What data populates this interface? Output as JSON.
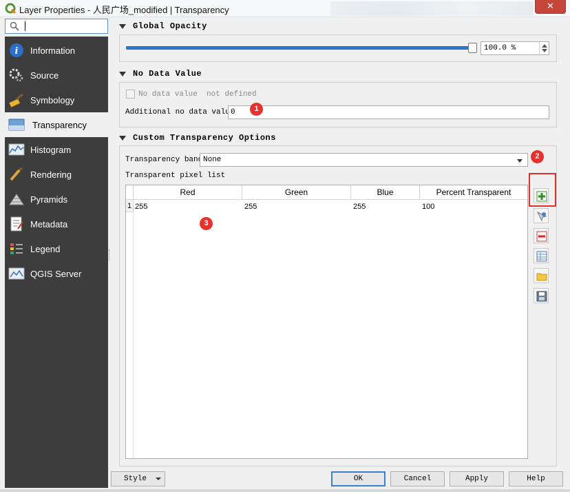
{
  "window": {
    "title": "Layer Properties - 人民广场_modified | Transparency",
    "close_label": "✕"
  },
  "search": {
    "value": ""
  },
  "sidebar": {
    "items": [
      {
        "label": "Information",
        "icon": "info-icon"
      },
      {
        "label": "Source",
        "icon": "source-icon"
      },
      {
        "label": "Symbology",
        "icon": "symbology-icon"
      },
      {
        "label": "Transparency",
        "icon": "transparency-icon",
        "active": true
      },
      {
        "label": "Histogram",
        "icon": "histogram-icon"
      },
      {
        "label": "Rendering",
        "icon": "rendering-icon"
      },
      {
        "label": "Pyramids",
        "icon": "pyramids-icon"
      },
      {
        "label": "Metadata",
        "icon": "metadata-icon"
      },
      {
        "label": "Legend",
        "icon": "legend-icon"
      },
      {
        "label": "QGIS Server",
        "icon": "qgis-server-icon"
      }
    ]
  },
  "global_opacity": {
    "header": "Global Opacity",
    "value_text": "100.0 %",
    "level": 1.0
  },
  "no_data": {
    "header": "No Data Value",
    "checkbox_label": "No data value  not defined",
    "additional_label": "Additional no data value",
    "additional_value": "0"
  },
  "custom_transparency": {
    "header": "Custom Transparency Options",
    "band_label": "Transparency band",
    "band_value": "None",
    "pixel_list_label": "Transparent pixel list",
    "columns": [
      "Red",
      "Green",
      "Blue",
      "Percent Transparent"
    ],
    "rows": [
      {
        "num": "1",
        "cells": [
          "255",
          "255",
          "255",
          "100"
        ]
      }
    ]
  },
  "badges": [
    "1",
    "2",
    "3"
  ],
  "buttons": {
    "style": "Style",
    "ok": "OK",
    "cancel": "Cancel",
    "apply": "Apply",
    "help": "Help"
  },
  "colors": {
    "sidebar_bg": "#3d3d3d",
    "accent": "#2f7bd3",
    "badge": "#e8302c"
  }
}
